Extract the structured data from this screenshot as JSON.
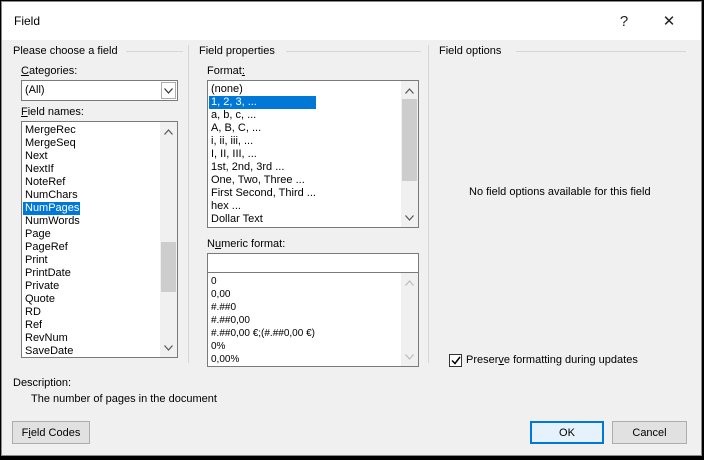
{
  "title": "Field",
  "titlebar": {
    "help": "?",
    "close": "✕"
  },
  "choose": {
    "heading": "Please choose a field",
    "categories_label_u": "C",
    "categories_label_rest": "ategories:",
    "categories_value": "(All)",
    "fieldnames_label_u": "F",
    "fieldnames_label_rest": "ield names:",
    "fields": [
      "MergeRec",
      "MergeSeq",
      "Next",
      "NextIf",
      "NoteRef",
      "NumChars",
      "NumPages",
      "NumWords",
      "Page",
      "PageRef",
      "Print",
      "PrintDate",
      "Private",
      "Quote",
      "RD",
      "Ref",
      "RevNum",
      "SaveDate"
    ],
    "selected_field": "NumPages"
  },
  "properties": {
    "heading": "Field properties",
    "format_label_pre": "Format",
    "format_label_u": ":",
    "formats": [
      "(none)",
      "1, 2, 3, ...",
      "a, b, c, ...",
      "A, B, C, ...",
      "i, ii, iii, ...",
      "I, II, III, ...",
      "1st, 2nd, 3rd ...",
      "One, Two, Three ...",
      "First Second, Third ...",
      "hex ...",
      "Dollar Text"
    ],
    "selected_format": "1, 2, 3, ...",
    "numeric_label_pre": "N",
    "numeric_label_u": "u",
    "numeric_label_rest": "meric format:",
    "numeric_value": "",
    "numeric_formats": [
      "0",
      "0,00",
      "#.##0",
      "#.##0,00",
      "#.##0,00 €;(#.##0,00 €)",
      "0%",
      "0,00%"
    ]
  },
  "options": {
    "heading": "Field options",
    "message": "No field options available for this field",
    "preserve_pre": "Preser",
    "preserve_u": "v",
    "preserve_rest": "e formatting during updates",
    "preserve_checked": true
  },
  "description": {
    "label": "Description:",
    "text": "The number of pages in the document"
  },
  "buttons": {
    "field_codes_pre": "F",
    "field_codes_u": "i",
    "field_codes_rest": "eld Codes",
    "ok": "OK",
    "cancel": "Cancel"
  }
}
